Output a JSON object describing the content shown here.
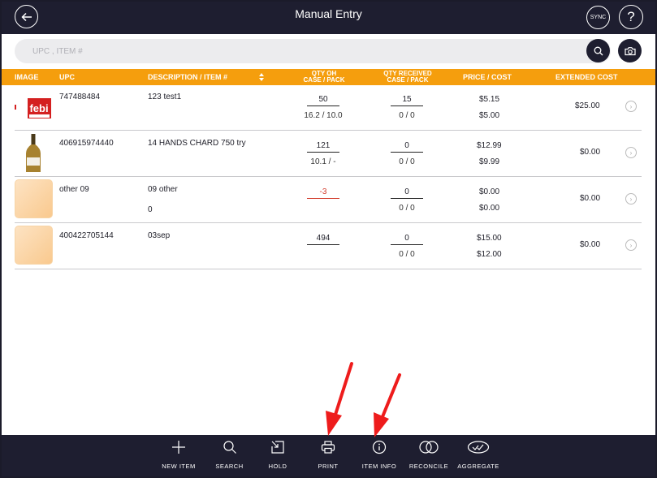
{
  "header": {
    "title": "Manual Entry",
    "sync_label": "SYNC",
    "help_label": "?"
  },
  "search": {
    "placeholder": "UPC , ITEM #"
  },
  "columns": {
    "image": "IMAGE",
    "upc": "UPC",
    "description": "DESCRIPTION / ITEM #",
    "qty_oh_1": "QTY OH",
    "qty_oh_2": "CASE / PACK",
    "qty_rec_1": "QTY RECEIVED",
    "qty_rec_2": "CASE / PACK",
    "price_cost": "PRICE / COST",
    "extended_cost": "EXTENDED COST"
  },
  "rows": [
    {
      "upc": "747488484",
      "description": "123 test1",
      "item_no": "",
      "qty_oh": "50",
      "qty_oh_sub": "16.2 / 10.0",
      "qty_received": "15",
      "qty_received_sub": "0 / 0",
      "price": "$5.15",
      "cost": "$5.00",
      "extended_cost": "$25.00",
      "image": "febi-logo"
    },
    {
      "upc": "406915974440",
      "description": "14 HANDS CHARD 750 try",
      "item_no": "",
      "qty_oh": "121",
      "qty_oh_sub": "10.1 / -",
      "qty_received": "0",
      "qty_received_sub": "0 / 0",
      "price": "$12.99",
      "cost": "$9.99",
      "extended_cost": "$0.00",
      "image": "wine-bottle"
    },
    {
      "upc": "other 09",
      "description": "09 other",
      "item_no": "0",
      "qty_oh": "-3",
      "qty_oh_sub": "",
      "qty_received": "0",
      "qty_received_sub": "0 / 0",
      "price": "$0.00",
      "cost": "$0.00",
      "extended_cost": "$0.00",
      "image": "placeholder"
    },
    {
      "upc": "400422705144",
      "description": "03sep",
      "item_no": "",
      "qty_oh": "494",
      "qty_oh_sub": "",
      "qty_received": "0",
      "qty_received_sub": "0 / 0",
      "price": "$15.00",
      "cost": "$12.00",
      "extended_cost": "$0.00",
      "image": "placeholder"
    }
  ],
  "toolbar": {
    "new_item": "NEW ITEM",
    "search": "SEARCH",
    "hold": "HOLD",
    "print": "PRINT",
    "item_info": "ITEM INFO",
    "reconcile": "RECONCILE",
    "aggregate": "AGGREGATE"
  },
  "colors": {
    "navy": "#1e1e30",
    "accent": "#f59e0d",
    "annotation": "#ee1c1c",
    "negative": "#d23a2a"
  }
}
